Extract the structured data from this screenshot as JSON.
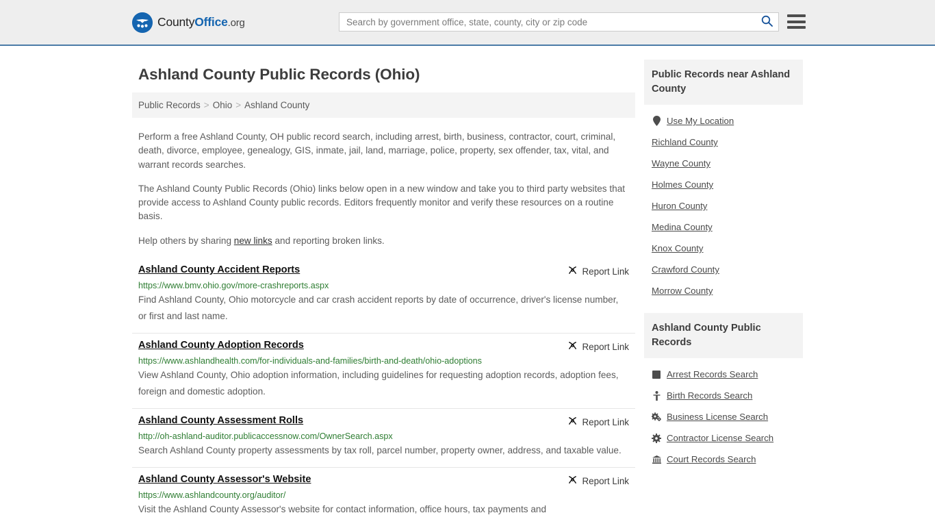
{
  "header": {
    "logo": {
      "icon": "eagle-shield-logo-icon",
      "text_county": "County",
      "text_office": "Office",
      "text_org": ".org"
    },
    "search": {
      "placeholder": "Search by government office, state, county, city or zip code",
      "value": "",
      "search_icon": "search-icon"
    },
    "menu_icon": "hamburger-menu-icon"
  },
  "main": {
    "title": "Ashland County Public Records (Ohio)",
    "breadcrumb": [
      {
        "label": "Public Records"
      },
      {
        "label": "Ohio"
      },
      {
        "label": "Ashland County"
      }
    ],
    "breadcrumb_separator": ">",
    "intro": {
      "p1": "Perform a free Ashland County, OH public record search, including arrest, birth, business, contractor, court, criminal, death, divorce, employee, genealogy, GIS, inmate, jail, land, marriage, police, property, sex offender, tax, vital, and warrant records searches.",
      "p2": "The Ashland County Public Records (Ohio) links below open in a new window and take you to third party websites that provide access to Ashland County public records. Editors frequently monitor and verify these resources on a routine basis.",
      "p3_before": "Help others by sharing ",
      "p3_link": "new links",
      "p3_after": " and reporting broken links."
    },
    "report_link_label": "Report Link",
    "report_link_icon": "broken-link-icon",
    "records": [
      {
        "title": "Ashland County Accident Reports",
        "url": "https://www.bmv.ohio.gov/more-crashreports.aspx",
        "description": "Find Ashland County, Ohio motorcycle and car crash accident reports by date of occurrence, driver's license number, or first and last name."
      },
      {
        "title": "Ashland County Adoption Records",
        "url": "https://www.ashlandhealth.com/for-individuals-and-families/birth-and-death/ohio-adoptions",
        "description": "View Ashland County, Ohio adoption information, including guidelines for requesting adoption records, adoption fees, foreign and domestic adoption."
      },
      {
        "title": "Ashland County Assessment Rolls",
        "url": "http://oh-ashland-auditor.publicaccessnow.com/OwnerSearch.aspx",
        "description": "Search Ashland County property assessments by tax roll, parcel number, property owner, address, and taxable value."
      },
      {
        "title": "Ashland County Assessor's Website",
        "url": "https://www.ashlandcounty.org/auditor/",
        "description": "Visit the Ashland County Assessor's website for contact information, office hours, tax payments and"
      }
    ]
  },
  "sidebar": {
    "nearby_panel": {
      "title": "Public Records near Ashland County",
      "items": [
        {
          "label": "Use My Location",
          "icon": "map-pin-icon"
        },
        {
          "label": "Richland County",
          "icon": ""
        },
        {
          "label": "Wayne County",
          "icon": ""
        },
        {
          "label": "Holmes County",
          "icon": ""
        },
        {
          "label": "Huron County",
          "icon": ""
        },
        {
          "label": "Medina County",
          "icon": ""
        },
        {
          "label": "Knox County",
          "icon": ""
        },
        {
          "label": "Crawford County",
          "icon": ""
        },
        {
          "label": "Morrow County",
          "icon": ""
        }
      ]
    },
    "records_panel": {
      "title": "Ashland County Public Records",
      "items": [
        {
          "label": "Arrest Records Search",
          "icon": "fingerprint-square-icon"
        },
        {
          "label": "Birth Records Search",
          "icon": "child-icon"
        },
        {
          "label": "Business License Search",
          "icon": "cogs-icon"
        },
        {
          "label": "Contractor License Search",
          "icon": "gear-icon"
        },
        {
          "label": "Court Records Search",
          "icon": "courthouse-icon"
        }
      ]
    }
  },
  "colors": {
    "brand_blue": "#1565b0",
    "header_bg": "#eeeeee",
    "header_border": "#4a7ba7",
    "url_green": "#2e7d32",
    "panel_bg": "#f3f3f3"
  }
}
